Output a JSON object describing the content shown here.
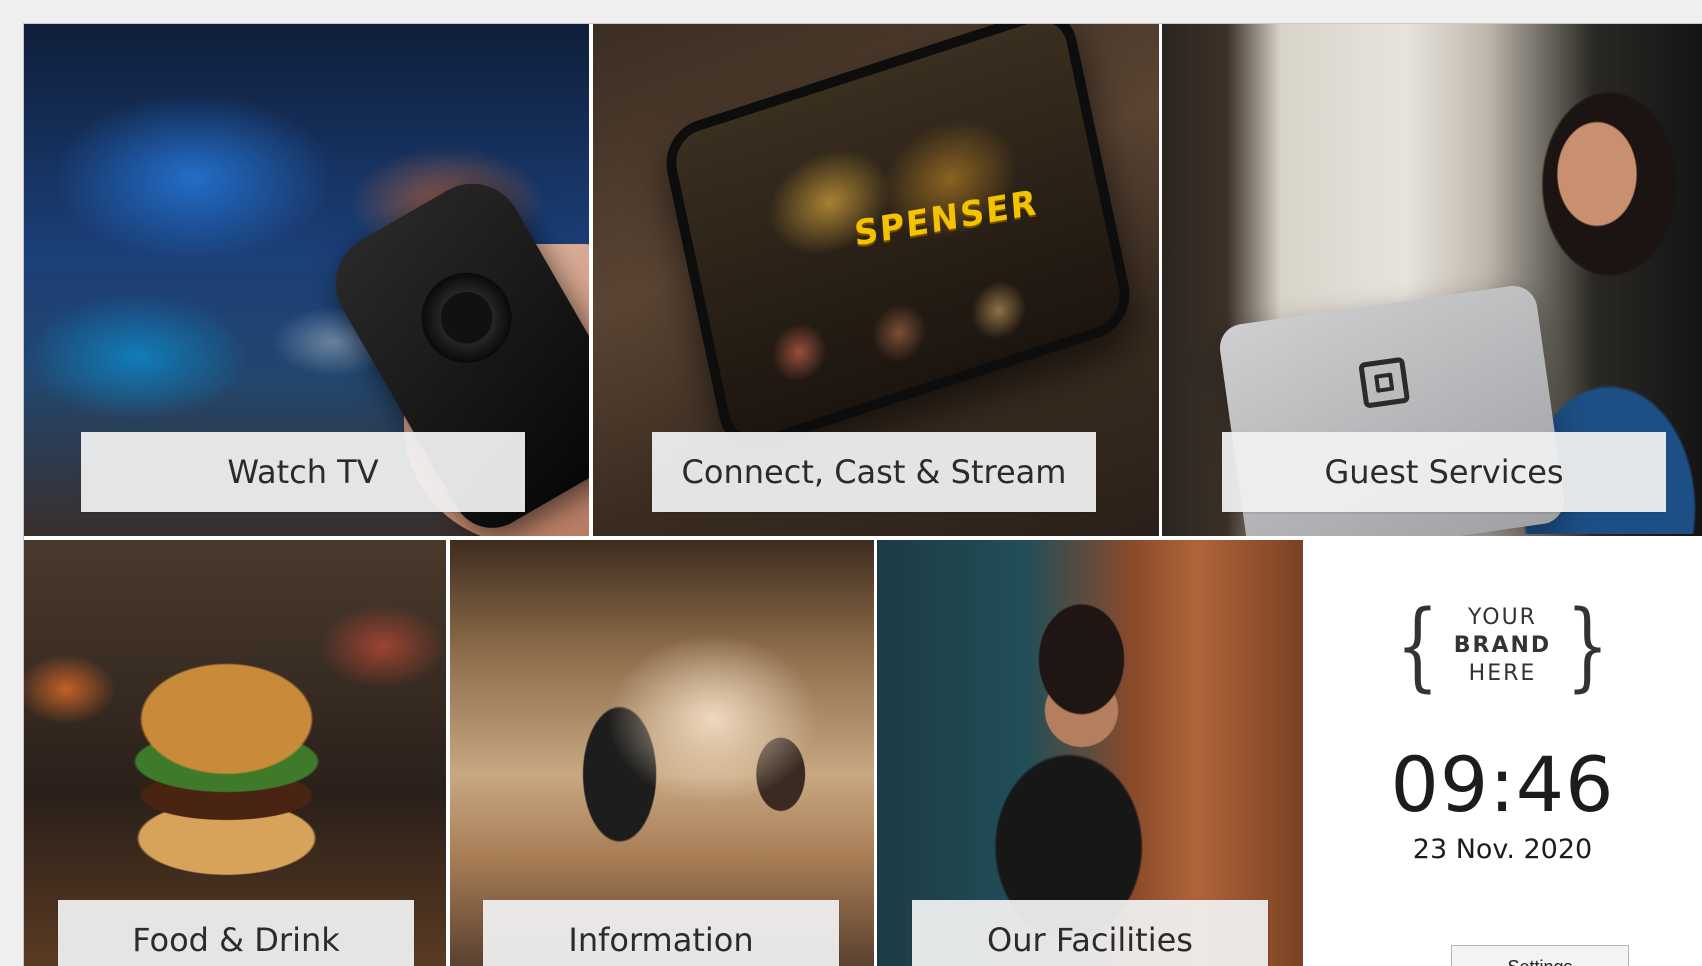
{
  "tiles": {
    "watch_tv": {
      "label": "Watch TV"
    },
    "connect": {
      "label": "Connect, Cast & Stream",
      "poster_title": "SPENSER"
    },
    "guest_services": {
      "label": "Guest Services"
    },
    "food_drink": {
      "label": "Food & Drink"
    },
    "information": {
      "label": "Information"
    },
    "facilities": {
      "label": "Our Facilities"
    }
  },
  "brand": {
    "line1": "YOUR",
    "line2": "BRAND",
    "line3": "HERE"
  },
  "clock": {
    "time": "09:46",
    "date": "23 Nov. 2020"
  },
  "settings": {
    "label": "Settings"
  }
}
